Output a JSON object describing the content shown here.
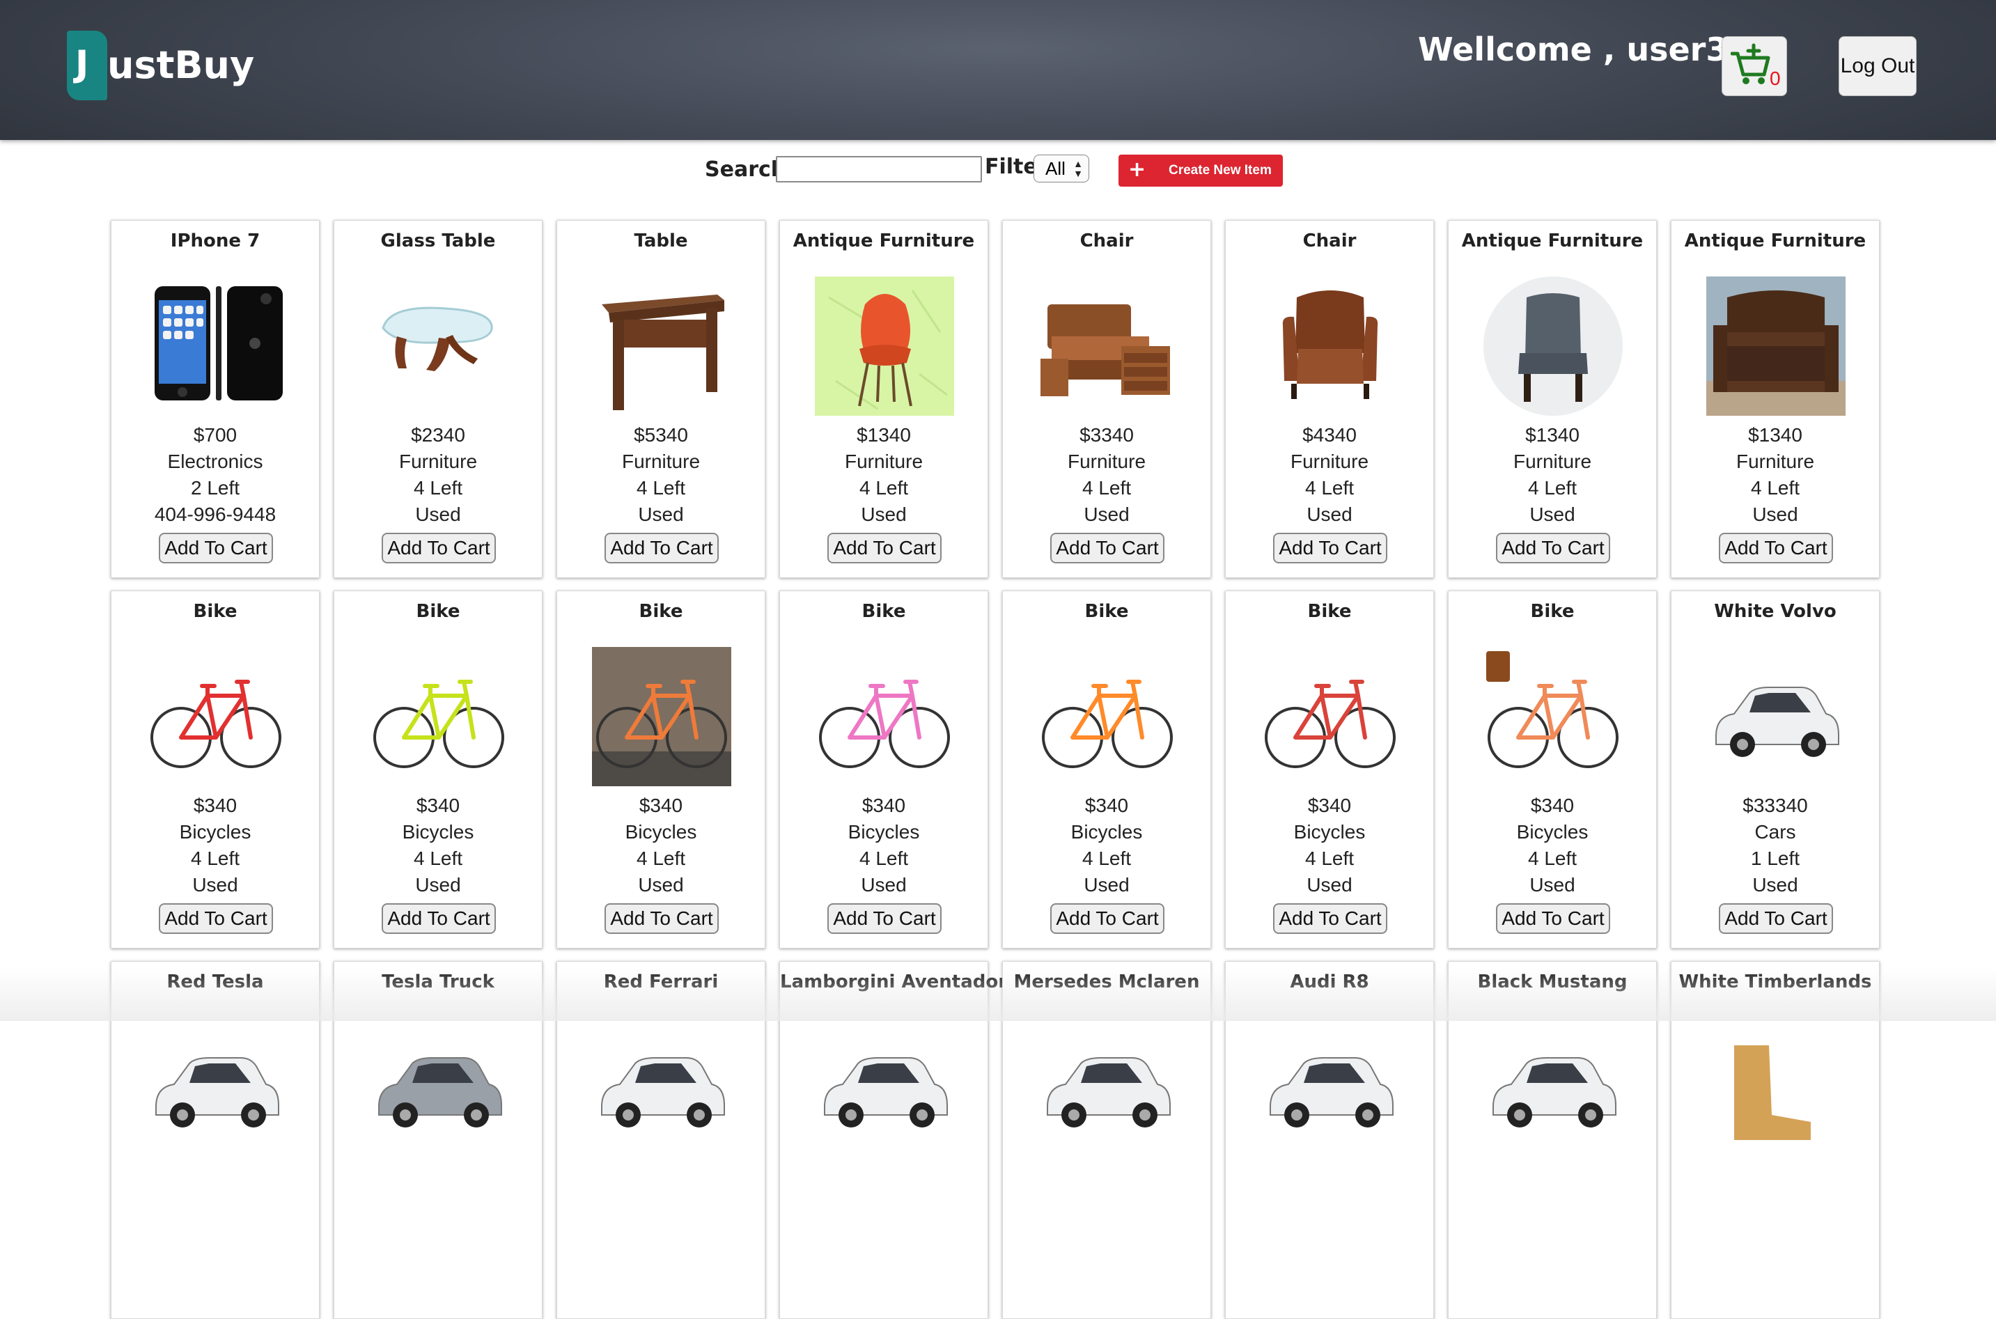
{
  "header": {
    "logo_initial": "J",
    "logo_rest": "ustBuy",
    "welcome": "Wellcome , user3",
    "cart_count": "0",
    "logout_label": "Log Out"
  },
  "toolbar": {
    "search_label": "Search:",
    "search_value": "",
    "filter_label": "Filter",
    "filter_selected": "All",
    "create_label": "Create New Item"
  },
  "products": [
    {
      "title": "IPhone 7",
      "price": "$700",
      "category": "Electronics",
      "stock": "2 Left",
      "condition": "404-996-9448",
      "button": "Add To Cart",
      "icon": "phone-image"
    },
    {
      "title": "Glass Table",
      "price": "$2340",
      "category": "Furniture",
      "stock": "4 Left",
      "condition": "Used",
      "button": "Add To Cart",
      "icon": "glass-table-image"
    },
    {
      "title": "Table",
      "price": "$5340",
      "category": "Furniture",
      "stock": "4 Left",
      "condition": "Used",
      "button": "Add To Cart",
      "icon": "table-image"
    },
    {
      "title": "Antique Furniture",
      "price": "$1340",
      "category": "Furniture",
      "stock": "4 Left",
      "condition": "Used",
      "button": "Add To Cart",
      "icon": "orange-chair-image"
    },
    {
      "title": "Chair",
      "price": "$3340",
      "category": "Furniture",
      "stock": "4 Left",
      "condition": "Used",
      "button": "Add To Cart",
      "icon": "bedroom-set-image"
    },
    {
      "title": "Chair",
      "price": "$4340",
      "category": "Furniture",
      "stock": "4 Left",
      "condition": "Used",
      "button": "Add To Cart",
      "icon": "leather-chair-image"
    },
    {
      "title": "Antique Furniture",
      "price": "$1340",
      "category": "Furniture",
      "stock": "4 Left",
      "condition": "Used",
      "button": "Add To Cart",
      "icon": "gray-chair-image"
    },
    {
      "title": "Antique Furniture",
      "price": "$1340",
      "category": "Furniture",
      "stock": "4 Left",
      "condition": "Used",
      "button": "Add To Cart",
      "icon": "antique-bench-image"
    },
    {
      "title": "Bike",
      "price": "$340",
      "category": "Bicycles",
      "stock": "4 Left",
      "condition": "Used",
      "button": "Add To Cart",
      "icon": "bike-image"
    },
    {
      "title": "Bike",
      "price": "$340",
      "category": "Bicycles",
      "stock": "4 Left",
      "condition": "Used",
      "button": "Add To Cart",
      "icon": "bike-image"
    },
    {
      "title": "Bike",
      "price": "$340",
      "category": "Bicycles",
      "stock": "4 Left",
      "condition": "Used",
      "button": "Add To Cart",
      "icon": "bike-image"
    },
    {
      "title": "Bike",
      "price": "$340",
      "category": "Bicycles",
      "stock": "4 Left",
      "condition": "Used",
      "button": "Add To Cart",
      "icon": "bike-image"
    },
    {
      "title": "Bike",
      "price": "$340",
      "category": "Bicycles",
      "stock": "4 Left",
      "condition": "Used",
      "button": "Add To Cart",
      "icon": "bike-image"
    },
    {
      "title": "Bike",
      "price": "$340",
      "category": "Bicycles",
      "stock": "4 Left",
      "condition": "Used",
      "button": "Add To Cart",
      "icon": "bike-image"
    },
    {
      "title": "Bike",
      "price": "$340",
      "category": "Bicycles",
      "stock": "4 Left",
      "condition": "Used",
      "button": "Add To Cart",
      "icon": "bike-image"
    },
    {
      "title": "White Volvo",
      "price": "$33340",
      "category": "Cars",
      "stock": "1 Left",
      "condition": "Used",
      "button": "Add To Cart",
      "icon": "car-image"
    },
    {
      "title": "Red Tesla",
      "icon": "car-image"
    },
    {
      "title": "Tesla Truck",
      "icon": "truck-image"
    },
    {
      "title": "Red Ferrari",
      "icon": "car-image"
    },
    {
      "title": "Lamborgini Aventador",
      "icon": "car-image"
    },
    {
      "title": "Mersedes Mclaren",
      "icon": "car-image"
    },
    {
      "title": "Audi R8",
      "icon": "car-image"
    },
    {
      "title": "Black Mustang",
      "icon": "car-image"
    },
    {
      "title": "White Timberlands",
      "icon": "boots-image"
    }
  ],
  "colors": {
    "header_bg": "#3b404a",
    "logo_accent": "#198582",
    "create_button": "#dc2530",
    "cart_icon": "#1f7a1f",
    "cart_count": "#e8141c"
  }
}
